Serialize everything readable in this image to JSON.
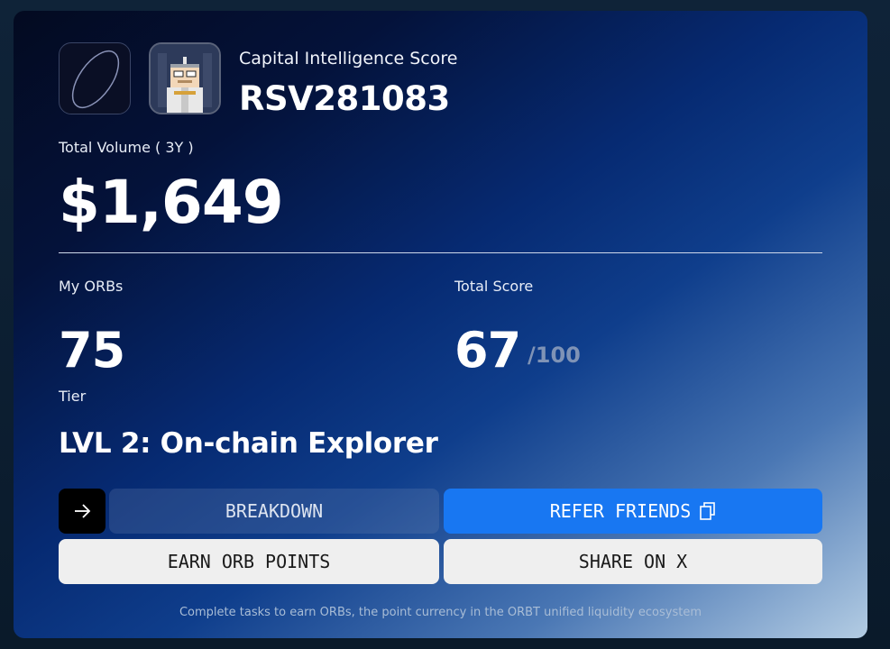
{
  "header": {
    "score_label": "Capital Intelligence Score",
    "score_id": "RSV281083"
  },
  "volume": {
    "label": "Total Volume ( 3Y )",
    "value": "$1,649"
  },
  "orbs": {
    "label": "My ORBs",
    "value": "75"
  },
  "total_score": {
    "label": "Total Score",
    "value": "67",
    "max": "/100"
  },
  "tier": {
    "label": "Tier",
    "value": "LVL 2: On-chain Explorer"
  },
  "buttons": {
    "arrow_icon": "arrow-right-icon",
    "breakdown": "BREAKDOWN",
    "refer": "REFER FRIENDS",
    "refer_icon": "copy-icon",
    "earn": "EARN ORB POINTS",
    "share": "SHARE ON X"
  },
  "footer": "Complete tasks to earn ORBs, the point currency in the ORBT unified liquidity ecosystem",
  "colors": {
    "accent_blue": "#1877f2",
    "light_button": "#efefef"
  }
}
